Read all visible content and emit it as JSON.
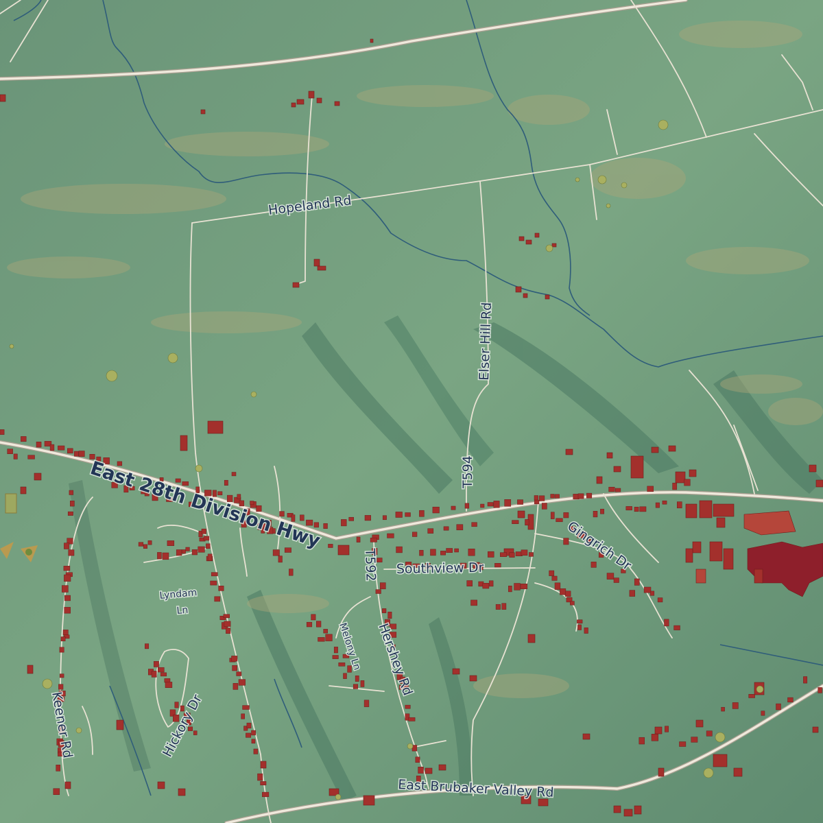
{
  "map": {
    "style": "shaded-relief",
    "colors": {
      "land": "#6f9a7c",
      "land_dark": "#4f7d66",
      "field": "#a9a679",
      "road": "#efe9dc",
      "road_casing": "#b7b0a0",
      "stream": "#2f5d7a",
      "building": "#a3302c",
      "building_edge": "#6e1d1b",
      "industrial": "#b5463a",
      "tree": "#9ea860",
      "label": "#233656"
    },
    "labels": {
      "hopeland_rd": "Hopeland Rd",
      "elser_hill_rd": "Elser Hill Rd",
      "t594": "T594",
      "east_28th_division_hwy": "East 28th Division Hwy",
      "t592": "T592",
      "southview_dr": "Southview Dr",
      "gingrich_dr": "Gingrich Dr",
      "lyndam": "Lyndam",
      "ln": "Ln",
      "melony_ln": "Melony Ln",
      "hershey_rd": "Hershey Rd",
      "hickory_dr": "Hickory Dr",
      "keener_rd": "Keener Rd",
      "east_brubaker_valley_rd": "East Brubaker Valley Rd"
    }
  }
}
